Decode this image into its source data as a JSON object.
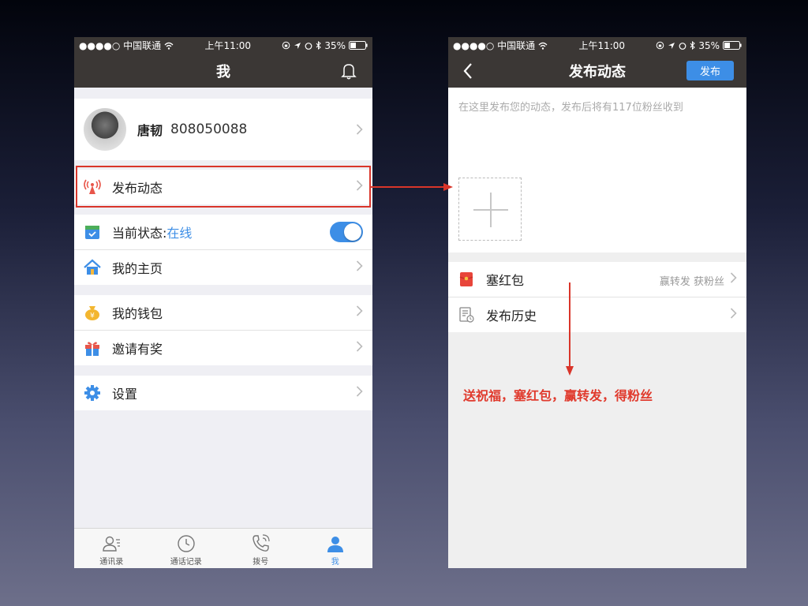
{
  "status_bar": {
    "carrier": "●●●●○ 中国联通",
    "time": "上午11:00",
    "battery": "35%"
  },
  "left": {
    "title": "我",
    "profile": {
      "name": "唐韧",
      "id": "808050088"
    },
    "rows": {
      "publish": "发布动态",
      "status_label": "当前状态: ",
      "status_value": "在线",
      "homepage": "我的主页",
      "wallet": "我的钱包",
      "invite": "邀请有奖",
      "settings": "设置"
    },
    "tabs": [
      "通讯录",
      "通话记录",
      "拨号",
      "我"
    ]
  },
  "right": {
    "title": "发布动态",
    "publish_button": "发布",
    "placeholder": "在这里发布您的动态，发布后将有117位粉丝收到",
    "red_packet": "塞红包",
    "red_packet_sub": "赢转发 获粉丝",
    "history": "发布历史"
  },
  "annotation": "送祝福，塞红包，赢转发，得粉丝",
  "colors": {
    "accent": "#3d8ee6",
    "annotation_red": "#d9352a",
    "navbar": "#3b3735"
  }
}
